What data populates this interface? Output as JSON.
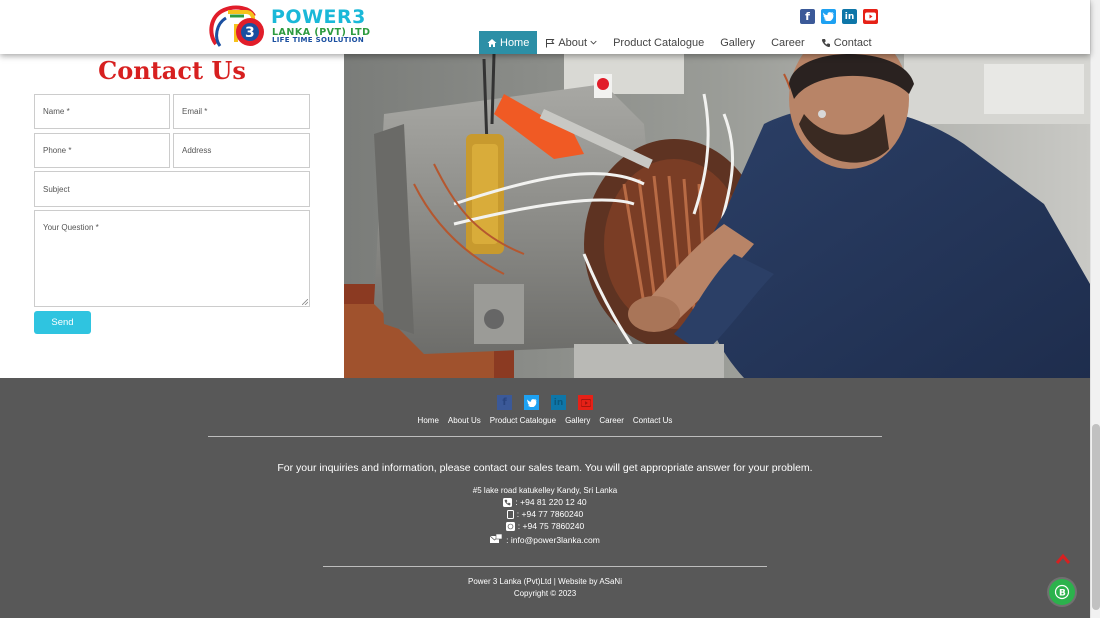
{
  "header": {
    "logo_main": "POWER3",
    "logo_sub": "LANKA (PVT) LTD",
    "logo_tagline": "LIFE TIME SOULUTION",
    "social": [
      {
        "name": "facebook",
        "color": "#3b5998",
        "glyph": "f"
      },
      {
        "name": "twitter",
        "color": "#1da1f2",
        "glyph": "t"
      },
      {
        "name": "linkedin",
        "color": "#0e76a8",
        "glyph": "in"
      },
      {
        "name": "youtube",
        "color": "#e62117",
        "glyph": "▶"
      }
    ],
    "nav": {
      "home": "Home",
      "about": "About",
      "products": "Product Catalogue",
      "gallery": "Gallery",
      "career": "Career",
      "contact": "Contact"
    },
    "accent": "#2c8fa6"
  },
  "contact_form": {
    "title": "Contact Us",
    "name_placeholder": "Name *",
    "email_placeholder": "Email *",
    "phone_placeholder": "Phone *",
    "address_placeholder": "Address",
    "subject_placeholder": "Subject",
    "question_placeholder": "Your Question *",
    "send_label": "Send",
    "title_color": "#d72020",
    "button_color": "#2fc4e0"
  },
  "footer": {
    "nav": [
      "Home",
      "About Us",
      "Product Catalogue",
      "Gallery",
      "Career",
      "Contact Us"
    ],
    "inquiry": "For your inquiries and information, please contact our sales team. You will get appropriate answer for your problem.",
    "address": "#5 lake road katukelley Kandy, Sri Lanka",
    "phone_1": ": +94 81 220 12 40",
    "mobile": ": +94 77 7860240",
    "whatsapp": ": +94 75 7860240",
    "email": ": info@power3lanka.com",
    "credits": "Power 3 Lanka (Pvt)Ltd  |  Website by ASaNi",
    "copyright": "Copyright © 2023",
    "background": "#585858"
  },
  "floating": {
    "bot_glyph": "B",
    "bot_color": "#2bb24c",
    "scroll_top_color": "#d72020"
  }
}
